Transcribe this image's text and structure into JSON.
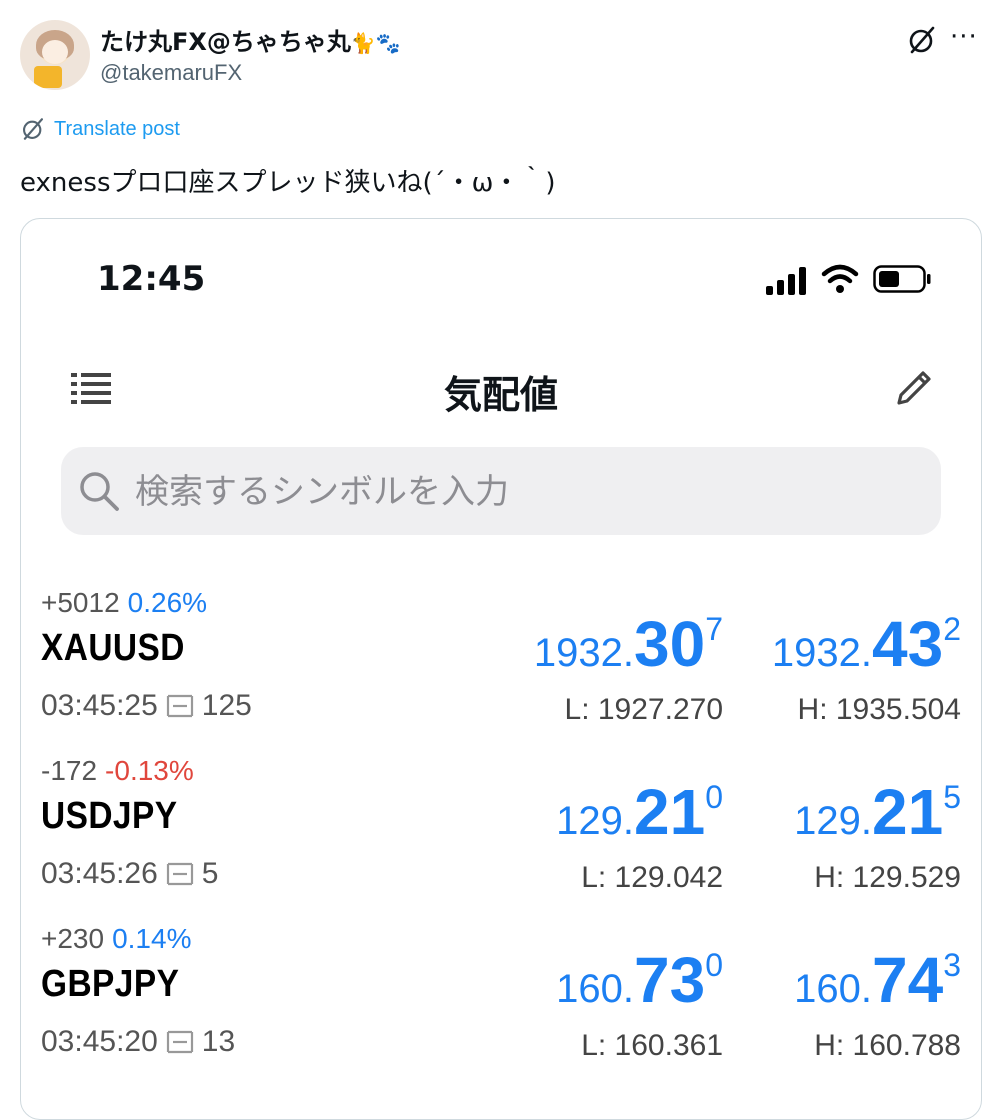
{
  "tweet": {
    "display_name": "たけ丸FX@ちゃちゃ丸",
    "emoji_cat": "🐈",
    "emoji_paw": "🐾",
    "handle": "@takemaruFX",
    "more_glyph": "···",
    "translate_label": "Translate post",
    "text": "exnessプロ口座スプレッド狭いね(´・ω・｀)"
  },
  "phone": {
    "time": "12:45",
    "screen_title": "気配値",
    "search_placeholder": "検索するシンボルを入力",
    "quotes": [
      {
        "change_points": "+5012",
        "change_percent": "0.26%",
        "change_color": "#1c7ff2",
        "symbol": "XAUUSD",
        "time": "03:45:25",
        "spread": "125",
        "bid": {
          "prefix": "1932.",
          "big": "30",
          "sup": "7"
        },
        "ask": {
          "prefix": "1932.",
          "big": "43",
          "sup": "2"
        },
        "low": "L: 1927.270",
        "high": "H: 1935.504"
      },
      {
        "change_points": "-172",
        "change_percent": "-0.13%",
        "change_color": "#e0463c",
        "symbol": "USDJPY",
        "time": "03:45:26",
        "spread": "5",
        "bid": {
          "prefix": "129.",
          "big": "21",
          "sup": "0"
        },
        "ask": {
          "prefix": "129.",
          "big": "21",
          "sup": "5"
        },
        "low": "L: 129.042",
        "high": "H: 129.529"
      },
      {
        "change_points": "+230",
        "change_percent": "0.14%",
        "change_color": "#1c7ff2",
        "symbol": "GBPJPY",
        "time": "03:45:20",
        "spread": "13",
        "bid": {
          "prefix": "160.",
          "big": "73",
          "sup": "0"
        },
        "ask": {
          "prefix": "160.",
          "big": "74",
          "sup": "3"
        },
        "low": "L: 160.361",
        "high": "H: 160.788"
      }
    ]
  },
  "colors": {
    "accent_blue": "#1c7ff2",
    "negative_red": "#e0463c",
    "link_blue": "#1d9bf0"
  }
}
